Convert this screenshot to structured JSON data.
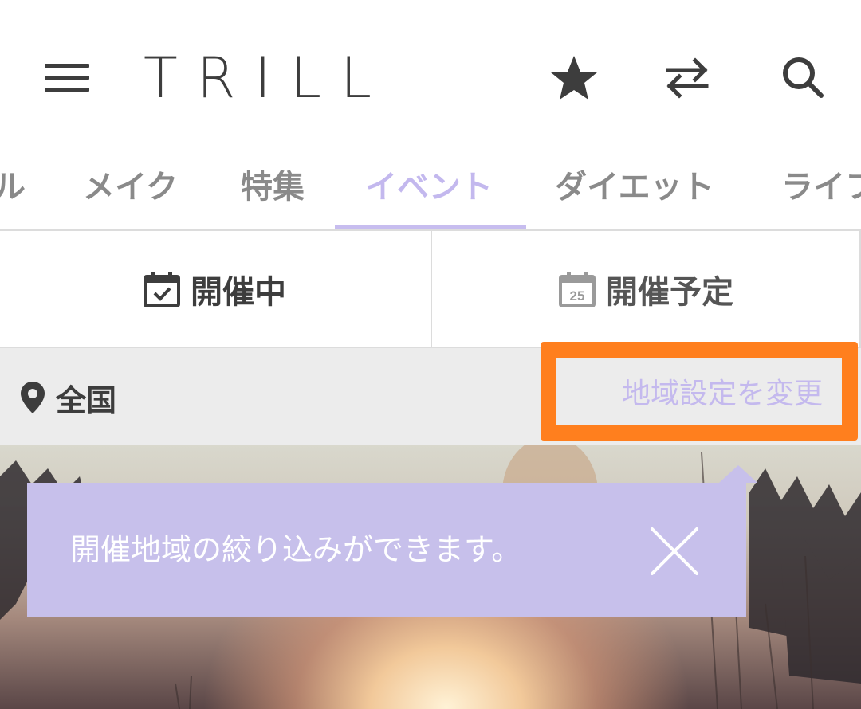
{
  "header": {
    "logo_text": "TRILL",
    "icons": [
      "menu-icon",
      "star-icon",
      "switch-icon",
      "search-icon"
    ]
  },
  "tabs": {
    "items": [
      {
        "label": "ル",
        "active": false
      },
      {
        "label": "メイク",
        "active": false
      },
      {
        "label": "特集",
        "active": false
      },
      {
        "label": "イベント",
        "active": true
      },
      {
        "label": "ダイエット",
        "active": false
      },
      {
        "label": "ライフ",
        "active": false
      }
    ],
    "active_color": "#c3b8ee",
    "inactive_color": "#8a8a8a"
  },
  "segments": {
    "ongoing_label": "開催中",
    "upcoming_label": "開催予定",
    "upcoming_calendar_day": "25"
  },
  "region": {
    "current_label": "全国",
    "change_label": "地域設定を変更",
    "highlight_color": "#ff7f1e"
  },
  "tooltip": {
    "text": "開催地域の絞り込みができます。",
    "background": "#c7c0eb"
  }
}
